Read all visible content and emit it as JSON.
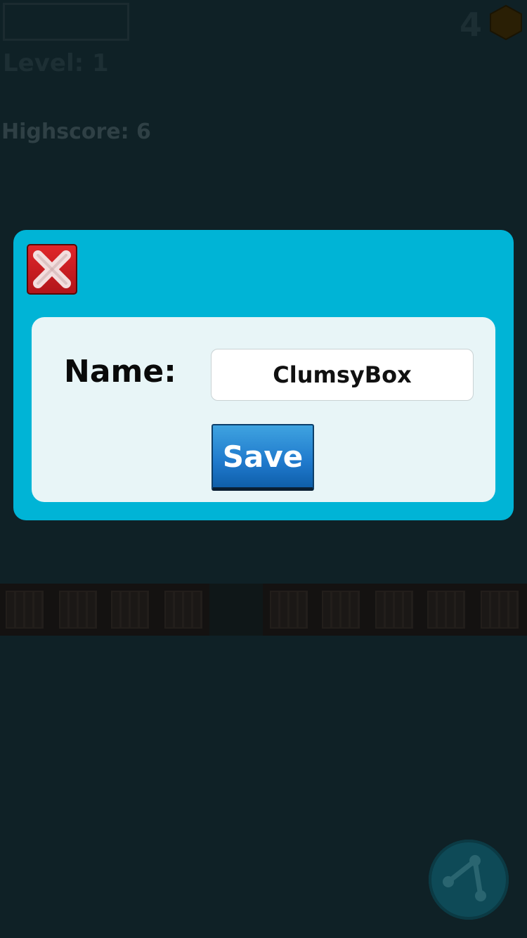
{
  "hud": {
    "coins": "4",
    "level": "Level: 1",
    "highscore": "Highscore: 6"
  },
  "dialog": {
    "name_label": "Name:",
    "name_value": "ClumsyBox",
    "save_label": "Save"
  },
  "colors": {
    "modal_bg": "#00b4d6",
    "panel_bg": "#e8f5f7",
    "close_red": "#d01f24",
    "save_blue": "#1f79cc"
  }
}
